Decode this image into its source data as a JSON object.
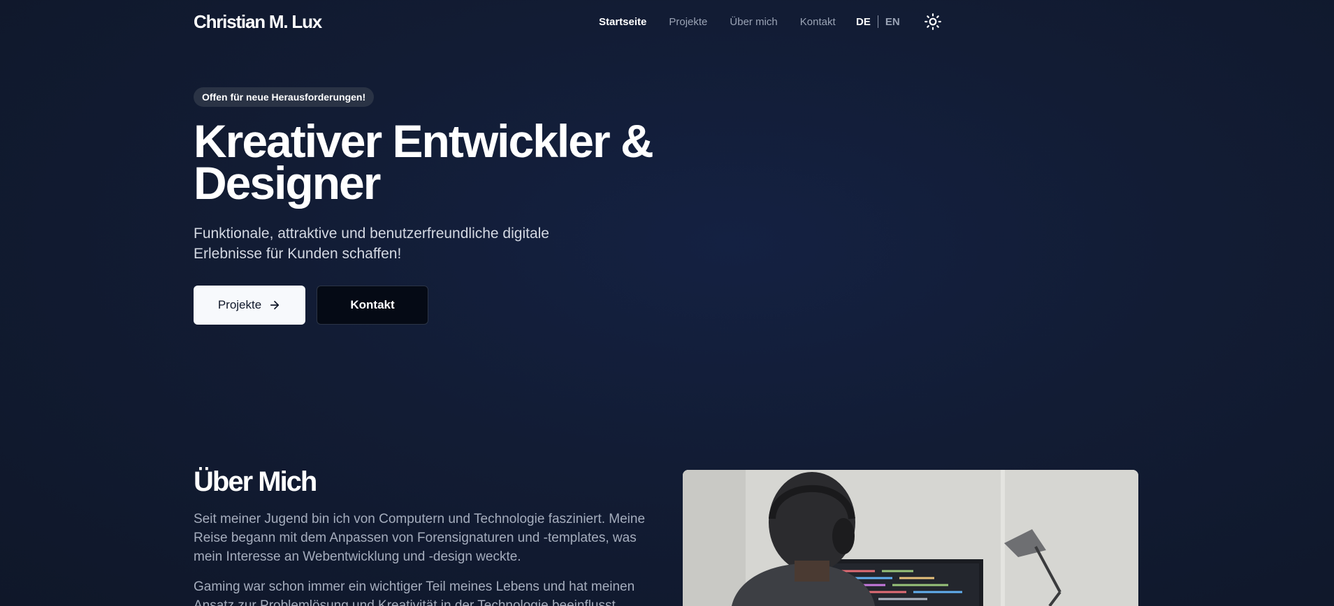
{
  "header": {
    "logo": "Christian M. Lux",
    "nav": [
      {
        "label": "Startseite",
        "active": true
      },
      {
        "label": "Projekte",
        "active": false
      },
      {
        "label": "Über mich",
        "active": false
      },
      {
        "label": "Kontakt",
        "active": false
      }
    ],
    "languages": {
      "active": "DE",
      "other": "EN"
    },
    "theme_icon": "sun-icon"
  },
  "hero": {
    "badge": "Offen für neue Herausforderungen!",
    "title_line1": "Kreativer Entwickler &",
    "title_line2": "Designer",
    "subtitle_line1": "Funktionale, attraktive und benutzerfreundliche digitale",
    "subtitle_line2": "Erlebnisse für Kunden schaffen!",
    "primary_button": "Projekte",
    "secondary_button": "Kontakt"
  },
  "about": {
    "title": "Über Mich",
    "paragraph1": "Seit meiner Jugend bin ich von Computern und Technologie fasziniert. Meine Reise begann mit dem Anpassen von Forensignaturen und -templates, was mein Interesse an Webentwicklung und -design weckte.",
    "paragraph2": "Gaming war schon immer ein wichtiger Teil meines Lebens und hat meinen Ansatz zur Problemlösung und Kreativität in der Technologie beeinflusst."
  },
  "colors": {
    "background": "#121c34",
    "accent": "#f7f9fc"
  }
}
